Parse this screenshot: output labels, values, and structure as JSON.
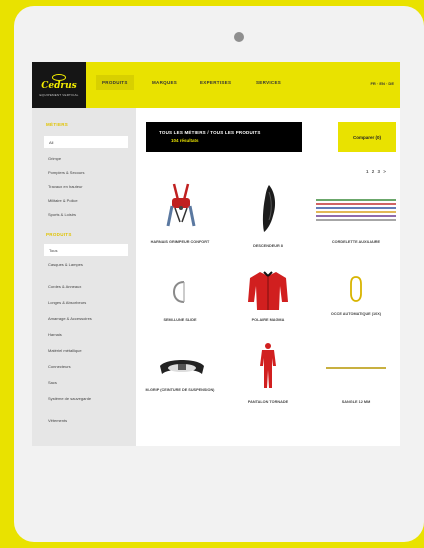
{
  "nav": {
    "brand": "Cedrus",
    "brand_sub": "EQUIPEMENT VERTICAL",
    "items": [
      "PRODUITS",
      "MARQUES",
      "EXPERTISES",
      "SERVICES"
    ],
    "lang": "FR · EN · DE"
  },
  "sidebar": {
    "metiers_heading": "MÉTIERS",
    "metiers": [
      "All",
      "Grimpe",
      "Pompiers & Secours",
      "Travaux en hauteur",
      "Militaire & Police",
      "Sports & Loisirs"
    ],
    "produits_heading": "PRODUITS",
    "produits": [
      "Tous",
      "Casques & Lampes",
      "Cordes & Anneaux",
      "Longes & Absorbeurs",
      "Amarrage & Accessoires",
      "Harnais",
      "Matériel métallique",
      "Connecteurs",
      "Sacs",
      "Système de sauvegarde",
      "Vêtements"
    ]
  },
  "banner": {
    "line1": "TOUS LES MÉTIERS / TOUS LES PRODUITS",
    "line2": "104 résultats"
  },
  "compare_label": "Comparer (0)",
  "pagination": "1 2 3 >",
  "products": [
    {
      "name": "HARNAIS GRIMPEUR CONFORT",
      "icon": "harness-icon"
    },
    {
      "name": "DESCENDEUR 8",
      "icon": "descender-icon"
    },
    {
      "name": "CORDELETTE AUXILIAIRE",
      "icon": "cord-bundle-icon"
    },
    {
      "name": "SEMI-LUNE SLIDE",
      "icon": "semi-moon-link-icon"
    },
    {
      "name": "POLAIRE MAGMA",
      "icon": "red-jacket-icon"
    },
    {
      "name": "OCCE AUTOMATIQUE (10X)",
      "icon": "carabiner-icon"
    },
    {
      "name": "M-GRIP (CEINTURE DE SUSPENSION)",
      "icon": "belt-icon"
    },
    {
      "name": "PANTALON TORNADE",
      "icon": "red-suit-icon"
    },
    {
      "name": "SANGLE 12 MM",
      "icon": "strap-icon"
    }
  ],
  "colors": {
    "accent": "#e9e200",
    "dark": "#151515",
    "sidebar": "#e6e6e6",
    "heading": "#e0c300",
    "product_red": "#d11f1f"
  }
}
